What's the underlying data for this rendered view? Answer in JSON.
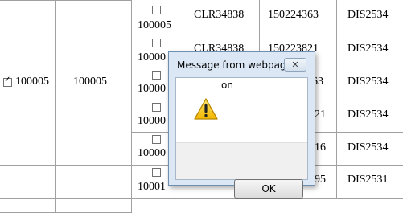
{
  "table": {
    "parent_row": {
      "checked": true,
      "id": "100005",
      "value": "100005"
    },
    "rows": [
      {
        "id": "100005",
        "code": "CLR34838",
        "number": "150224363",
        "dis": "DIS2534"
      },
      {
        "id": "10000",
        "code": "CLR34838",
        "number": "150223821",
        "dis": "DIS2534"
      },
      {
        "id": "10000",
        "code": "",
        "number": "63",
        "dis": "DIS2534"
      },
      {
        "id": "10000",
        "code": "",
        "number": "21",
        "dis": "DIS2534"
      },
      {
        "id": "10000",
        "code": "",
        "number": "16",
        "dis": "DIS2534"
      },
      {
        "id": "10001",
        "code": "",
        "number": "95",
        "dis": "DIS2531"
      }
    ]
  },
  "dialog": {
    "title": "Message from webpage",
    "close_label": "✕",
    "message": "on",
    "ok_label": "OK",
    "icon": "warning-icon"
  }
}
